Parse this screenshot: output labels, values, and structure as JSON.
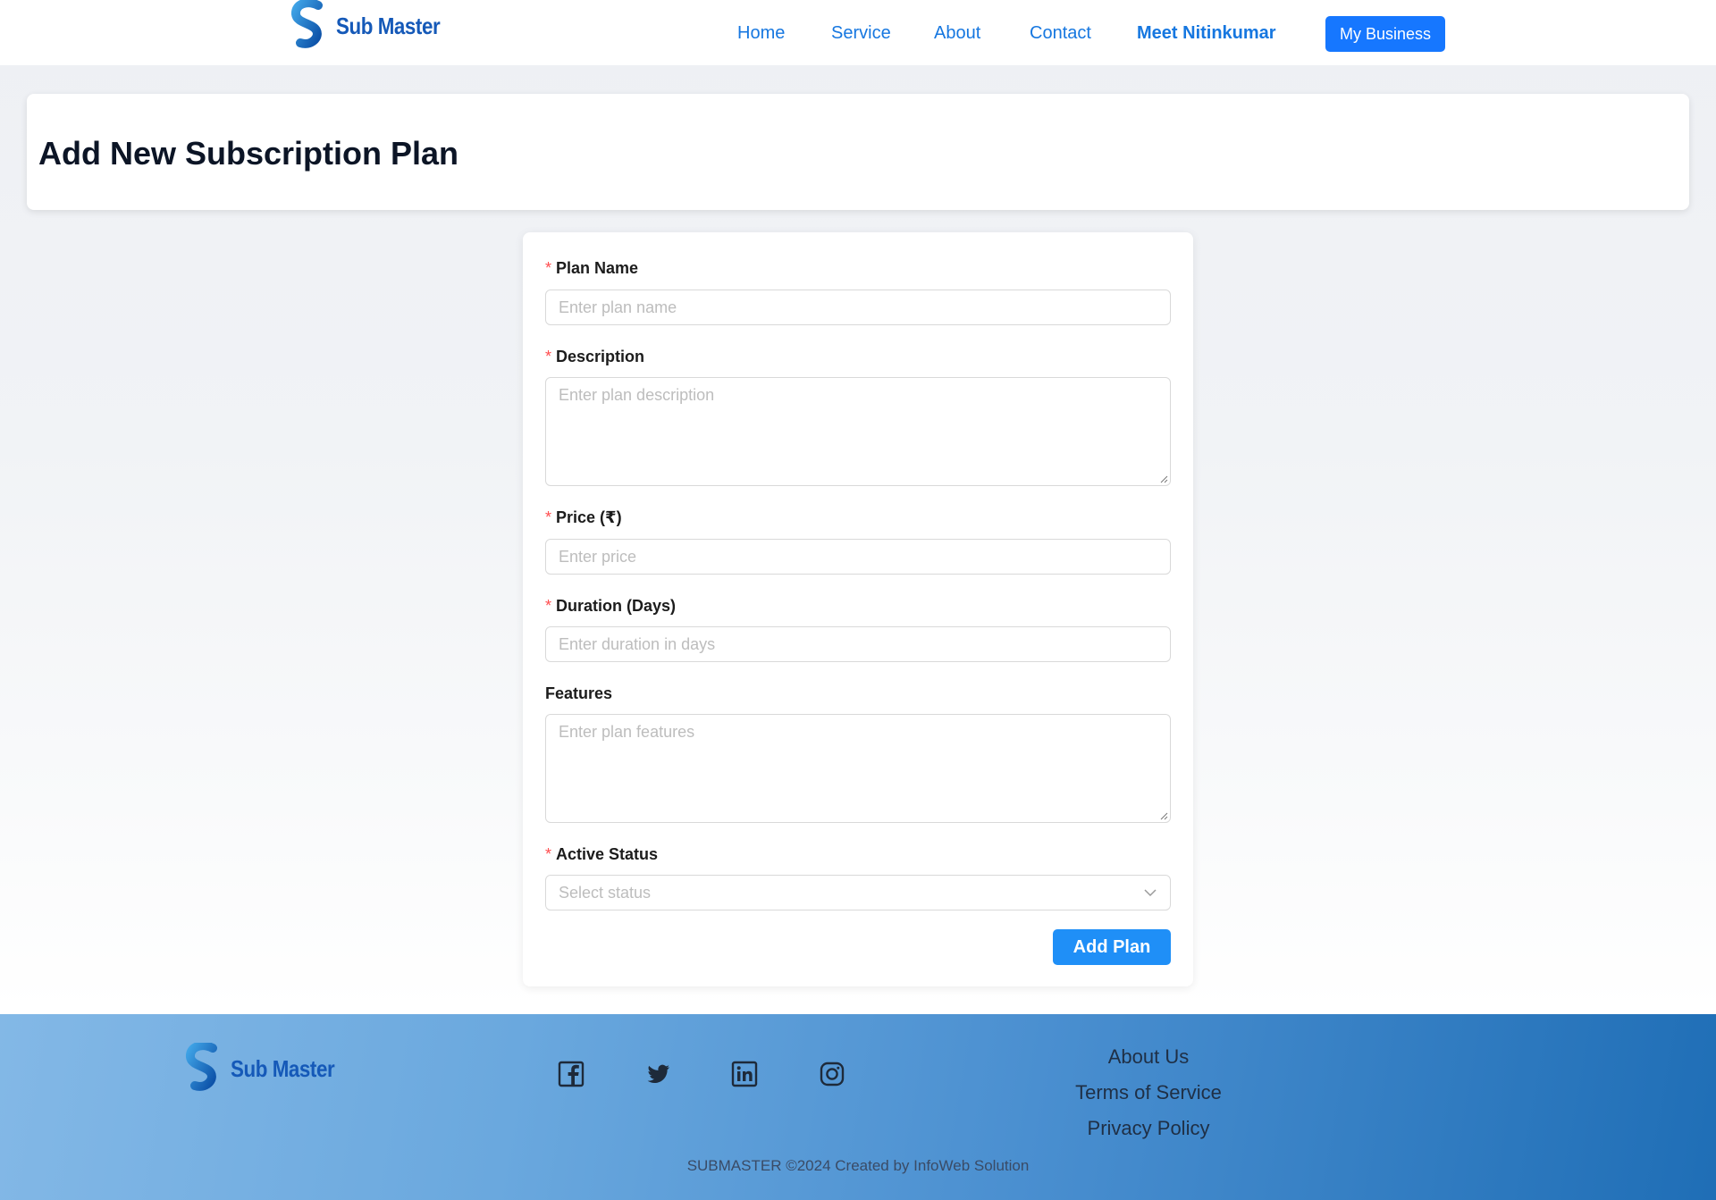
{
  "header": {
    "brand": "Sub Master",
    "nav": [
      {
        "label": "Home"
      },
      {
        "label": "Service"
      },
      {
        "label": "About"
      },
      {
        "label": "Contact"
      },
      {
        "label": "Meet Nitinkumar"
      }
    ],
    "business_button": "My Business"
  },
  "page": {
    "title": "Add New Subscription Plan"
  },
  "form": {
    "plan_name": {
      "label": "Plan Name",
      "placeholder": "Enter plan name",
      "value": ""
    },
    "description": {
      "label": "Description",
      "placeholder": "Enter plan description",
      "value": ""
    },
    "price": {
      "label": "Price (₹)",
      "placeholder": "Enter price",
      "value": ""
    },
    "duration": {
      "label": "Duration (Days)",
      "placeholder": "Enter duration in days",
      "value": ""
    },
    "features": {
      "label": "Features",
      "placeholder": "Enter plan features",
      "value": ""
    },
    "status": {
      "label": "Active Status",
      "placeholder": "Select status"
    },
    "required_mark": "*",
    "submit_label": "Add Plan"
  },
  "footer": {
    "brand": "Sub Master",
    "social": [
      "facebook-icon",
      "twitter-icon",
      "linkedin-icon",
      "instagram-icon"
    ],
    "links": [
      "About Us",
      "Terms of Service",
      "Privacy Policy"
    ],
    "copyright": "SUBMASTER ©2024 Created by InfoWeb Solution"
  },
  "colors": {
    "brand_blue": "#1559b8",
    "primary_button": "#1677ff",
    "nav_link": "#1677e0",
    "required": "#ff4d4f"
  }
}
